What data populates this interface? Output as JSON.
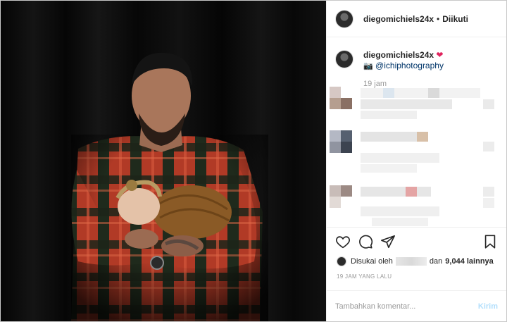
{
  "post": {
    "username": "diegomichiels24x",
    "separator": "•",
    "follow_status": "Diikuti",
    "image_alt": "Pria berkemeja flanel menggendong bayi yang dibungkus kain cokelat"
  },
  "caption": {
    "username": "diegomichiels24x",
    "heart": "❤",
    "camera": "📷",
    "mention": "@ichiphotography",
    "time": "19 jam"
  },
  "likes": {
    "prefix": "Disukai oleh",
    "conjunction": "dan",
    "count_text": "9,044 lainnya"
  },
  "timestamp": "19 JAM YANG LALU",
  "composer": {
    "placeholder": "Tambahkan komentar...",
    "send_label": "Kirim"
  },
  "icons": [
    "heart-icon",
    "comment-icon",
    "share-icon",
    "bookmark-icon"
  ],
  "colors": {
    "accent_link": "#003569",
    "send_disabled": "#b2dffc",
    "heart": "#e0245e"
  }
}
